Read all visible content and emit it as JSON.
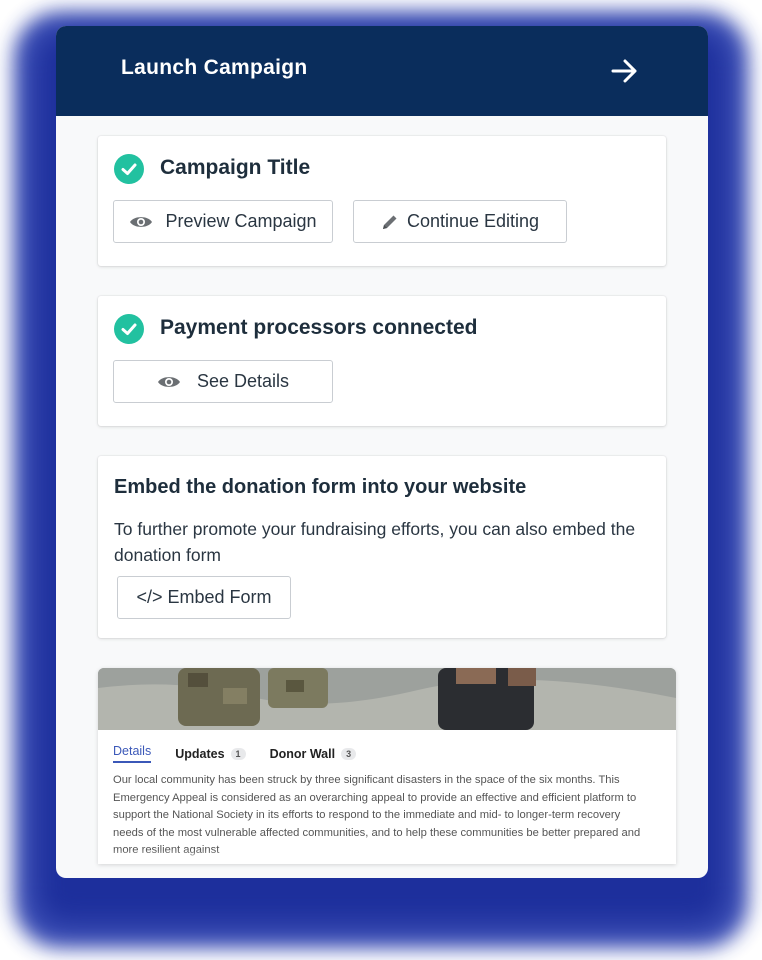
{
  "header": {
    "title": "Launch Campaign"
  },
  "sections": {
    "campaign": {
      "title": "Campaign Title",
      "preview_button": "Preview Campaign",
      "edit_button": "Continue Editing"
    },
    "payments": {
      "title": "Payment processors connected",
      "details_button": "See Details"
    },
    "embed": {
      "title": "Embed the donation form into your website",
      "description": "To further promote your fundraising efforts, you can also embed the donation form",
      "button": "</> Embed Form"
    }
  },
  "preview": {
    "tabs": [
      {
        "label": "Details"
      },
      {
        "label": "Updates",
        "count": "1"
      },
      {
        "label": "Donor Wall",
        "count": "3"
      }
    ],
    "story": "Our local community has been struck by three significant disasters in the space of the six months. This Emergency Appeal is considered as an overarching appeal to provide an effective and efficient platform to support the National Society in its efforts to respond to the immediate and mid- to longer-term recovery needs of the most vulnerable affected communities, and to help these communities be better prepared and more resilient against"
  },
  "colors": {
    "header_bg": "#0a2d5c",
    "check_green": "#22c1a0",
    "glow_blue": "#2a3fb0",
    "active_tab": "#3b58b8"
  },
  "icons": [
    "arrow-right-icon",
    "check-circle-icon",
    "eye-icon",
    "pencil-icon"
  ]
}
